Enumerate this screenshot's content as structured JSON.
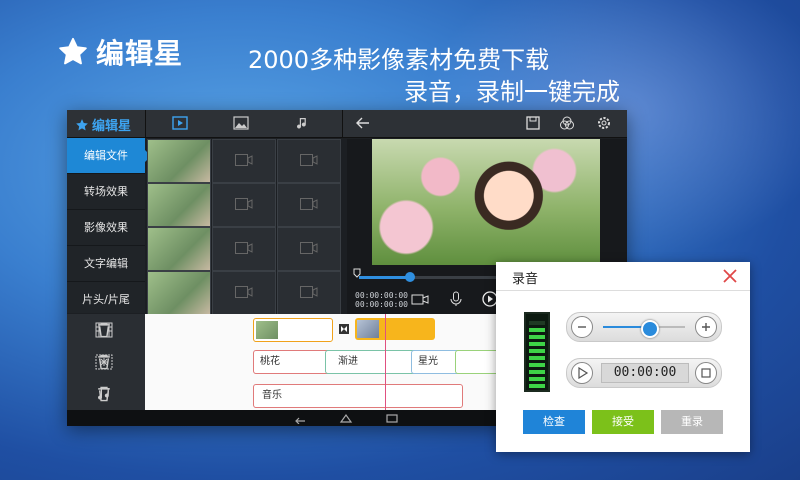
{
  "promo": {
    "brand_name": "编辑星",
    "tagline_1": "2000多种影像素材免费下载",
    "tagline_2": "录音，录制一键完成"
  },
  "app": {
    "logo_text": "编辑星",
    "top_tabs": [
      "video-tab-icon",
      "image-tab-icon",
      "music-tab-icon"
    ],
    "top_actions": [
      "back-arrow-icon",
      "save-icon",
      "filter-icon",
      "gear-icon"
    ],
    "sidebar": {
      "items": [
        {
          "label": "编辑文件",
          "active": true
        },
        {
          "label": "转场效果",
          "active": false
        },
        {
          "label": "影像效果",
          "active": false
        },
        {
          "label": "文字编辑",
          "active": false
        },
        {
          "label": "片头/片尾",
          "active": false
        }
      ]
    },
    "preview": {
      "time_current": "00:00:00:00",
      "time_total": "00:00:00:00",
      "playback_progress": 0.2
    },
    "timeline": {
      "text_clips": [
        "桃花",
        "渐进",
        "星光"
      ],
      "audio_clip": "音乐"
    }
  },
  "dialog": {
    "title": "录音",
    "timer": "00:00:00",
    "volume_level": 0.55,
    "meter_level": 0.85,
    "buttons": {
      "check": "检查",
      "accept": "接受",
      "rerecord": "重录"
    },
    "colors": {
      "check": "#1f84d8",
      "accept": "#7cc11a",
      "rerecord": "#b7b7b7"
    }
  }
}
